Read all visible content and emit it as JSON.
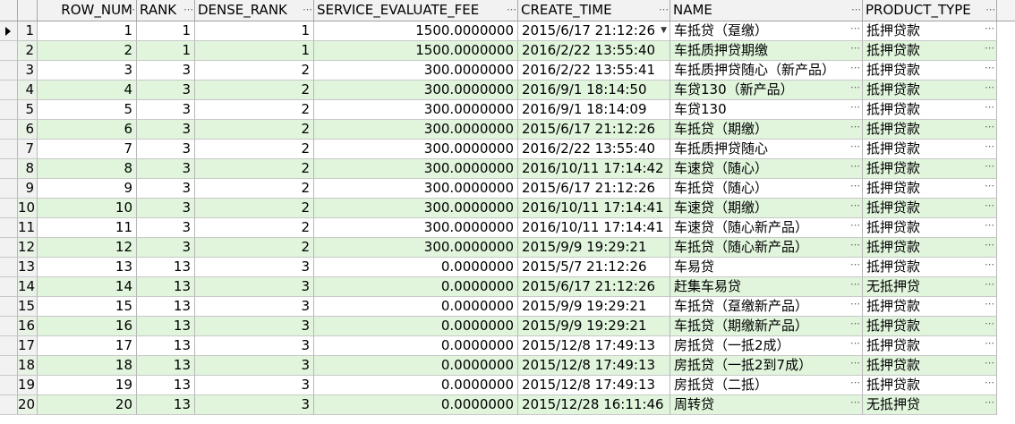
{
  "columns": [
    "ROW_NUM",
    "RANK",
    "DENSE_RANK",
    "SERVICE_EVALUATE_FEE",
    "CREATE_TIME",
    "NAME",
    "PRODUCT_TYPE"
  ],
  "rows": [
    {
      "n": "1",
      "row_num": "1",
      "rank": "1",
      "dense_rank": "1",
      "fee": "1500.0000000",
      "time": "2015/6/17 21:12:26",
      "name": "车抵贷（趸缴）",
      "type": "抵押贷款"
    },
    {
      "n": "2",
      "row_num": "2",
      "rank": "1",
      "dense_rank": "1",
      "fee": "1500.0000000",
      "time": "2016/2/22 13:55:40",
      "name": "车抵质押贷期缴",
      "type": "抵押贷款"
    },
    {
      "n": "3",
      "row_num": "3",
      "rank": "3",
      "dense_rank": "2",
      "fee": "300.0000000",
      "time": "2016/2/22 13:55:41",
      "name": "车抵质押贷随心（新产品）",
      "type": "抵押贷款"
    },
    {
      "n": "4",
      "row_num": "4",
      "rank": "3",
      "dense_rank": "2",
      "fee": "300.0000000",
      "time": "2016/9/1 18:14:50",
      "name": "车贷130（新产品）",
      "type": "抵押贷款"
    },
    {
      "n": "5",
      "row_num": "5",
      "rank": "3",
      "dense_rank": "2",
      "fee": "300.0000000",
      "time": "2016/9/1 18:14:09",
      "name": "车贷130",
      "type": "抵押贷款"
    },
    {
      "n": "6",
      "row_num": "6",
      "rank": "3",
      "dense_rank": "2",
      "fee": "300.0000000",
      "time": "2015/6/17 21:12:26",
      "name": "车抵贷（期缴）",
      "type": "抵押贷款"
    },
    {
      "n": "7",
      "row_num": "7",
      "rank": "3",
      "dense_rank": "2",
      "fee": "300.0000000",
      "time": "2016/2/22 13:55:40",
      "name": "车抵质押贷随心",
      "type": "抵押贷款"
    },
    {
      "n": "8",
      "row_num": "8",
      "rank": "3",
      "dense_rank": "2",
      "fee": "300.0000000",
      "time": "2016/10/11 17:14:42",
      "name": "车速贷（随心）",
      "type": "抵押贷款"
    },
    {
      "n": "9",
      "row_num": "9",
      "rank": "3",
      "dense_rank": "2",
      "fee": "300.0000000",
      "time": "2015/6/17 21:12:26",
      "name": "车抵贷（随心）",
      "type": "抵押贷款"
    },
    {
      "n": "10",
      "row_num": "10",
      "rank": "3",
      "dense_rank": "2",
      "fee": "300.0000000",
      "time": "2016/10/11 17:14:41",
      "name": "车速贷（期缴）",
      "type": "抵押贷款"
    },
    {
      "n": "11",
      "row_num": "11",
      "rank": "3",
      "dense_rank": "2",
      "fee": "300.0000000",
      "time": "2016/10/11 17:14:41",
      "name": "车速贷（随心新产品）",
      "type": "抵押贷款"
    },
    {
      "n": "12",
      "row_num": "12",
      "rank": "3",
      "dense_rank": "2",
      "fee": "300.0000000",
      "time": "2015/9/9 19:29:21",
      "name": "车抵贷（随心新产品）",
      "type": "抵押贷款"
    },
    {
      "n": "13",
      "row_num": "13",
      "rank": "13",
      "dense_rank": "3",
      "fee": "0.0000000",
      "time": "2015/5/7 21:12:26",
      "name": "车易贷",
      "type": "抵押贷款"
    },
    {
      "n": "14",
      "row_num": "14",
      "rank": "13",
      "dense_rank": "3",
      "fee": "0.0000000",
      "time": "2015/6/17 21:12:26",
      "name": "赶集车易贷",
      "type": "无抵押贷"
    },
    {
      "n": "15",
      "row_num": "15",
      "rank": "13",
      "dense_rank": "3",
      "fee": "0.0000000",
      "time": "2015/9/9 19:29:21",
      "name": "车抵贷（趸缴新产品）",
      "type": "抵押贷款"
    },
    {
      "n": "16",
      "row_num": "16",
      "rank": "13",
      "dense_rank": "3",
      "fee": "0.0000000",
      "time": "2015/9/9 19:29:21",
      "name": "车抵贷（期缴新产品）",
      "type": "抵押贷款"
    },
    {
      "n": "17",
      "row_num": "17",
      "rank": "13",
      "dense_rank": "3",
      "fee": "0.0000000",
      "time": "2015/12/8 17:49:13",
      "name": "房抵贷（一抵2成）",
      "type": "抵押贷款"
    },
    {
      "n": "18",
      "row_num": "18",
      "rank": "13",
      "dense_rank": "3",
      "fee": "0.0000000",
      "time": "2015/12/8 17:49:13",
      "name": "房抵贷（一抵2到7成）",
      "type": "抵押贷款"
    },
    {
      "n": "19",
      "row_num": "19",
      "rank": "13",
      "dense_rank": "3",
      "fee": "0.0000000",
      "time": "2015/12/8 17:49:13",
      "name": "房抵贷（二抵）",
      "type": "抵押贷款"
    },
    {
      "n": "20",
      "row_num": "20",
      "rank": "13",
      "dense_rank": "3",
      "fee": "0.0000000",
      "time": "2015/12/28 16:11:46",
      "name": "周转贷",
      "type": "无抵押贷"
    }
  ],
  "icons": {
    "row_pointer": "current-row-pointer-icon",
    "dropdown": "dropdown-arrow-icon",
    "ellipsis": "ellipsis-button-icon"
  },
  "colors": {
    "alt_row": "#e0f5dc",
    "header": "#f2f2f2",
    "grid": "#b8b8b8"
  }
}
